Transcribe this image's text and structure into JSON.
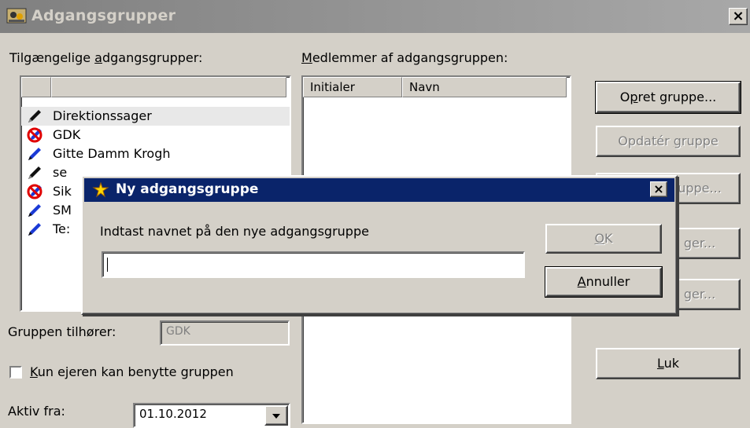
{
  "window": {
    "title": "Adgangsgrupper",
    "close_label": "×"
  },
  "groups_panel": {
    "label_pre": "Tilgængelige ",
    "label_ul": "a",
    "label_post": "dgangsgrupper:",
    "items": [
      {
        "label": "Direktionssager",
        "icon": "pen-black-icon"
      },
      {
        "label": "GDK",
        "icon": "forbidden-pen-icon"
      },
      {
        "label": "Gitte Damm Krogh",
        "icon": "pen-blue-icon"
      },
      {
        "label": "se",
        "icon": "pen-black-icon"
      },
      {
        "label": "Sik",
        "icon": "forbidden-pen-icon"
      },
      {
        "label": "SM",
        "icon": "pen-blue-icon"
      },
      {
        "label": "Te:",
        "icon": "pen-blue-icon"
      }
    ]
  },
  "members_panel": {
    "label_ul": "M",
    "label_post": "edlemmer af adgangsgruppen:",
    "columns": [
      "Initialer",
      "Navn"
    ]
  },
  "owner": {
    "label": "Gruppen tilhører:",
    "value": "GDK"
  },
  "owner_only": {
    "label_ul": "K",
    "label_post": "un ejeren kan benytte gruppen",
    "checked": false
  },
  "active_from": {
    "label": "Aktiv fra:",
    "value": "01.10.2012"
  },
  "buttons": {
    "create_pre": "O",
    "create_ul": "p",
    "create_post": "ret gruppe...",
    "update_pre": "Opdatér ",
    "update_ul": "g",
    "update_post": "ruppe",
    "hidden3": "uppe...",
    "hidden4": "ger...",
    "hidden5": "ger...",
    "close_ul": "L",
    "close_post": "uk"
  },
  "dialog": {
    "title": "Ny adgangsgruppe",
    "close_label": "×",
    "prompt": "Indtast navnet på den nye adgangsgruppe",
    "input_value": "",
    "ok_ul": "O",
    "ok_post": "K",
    "cancel_ul": "A",
    "cancel_post": "nnuller"
  },
  "colors": {
    "dialog_title": "#0a246a",
    "face": "#d4d0c8",
    "inactive_title": "#808080"
  }
}
